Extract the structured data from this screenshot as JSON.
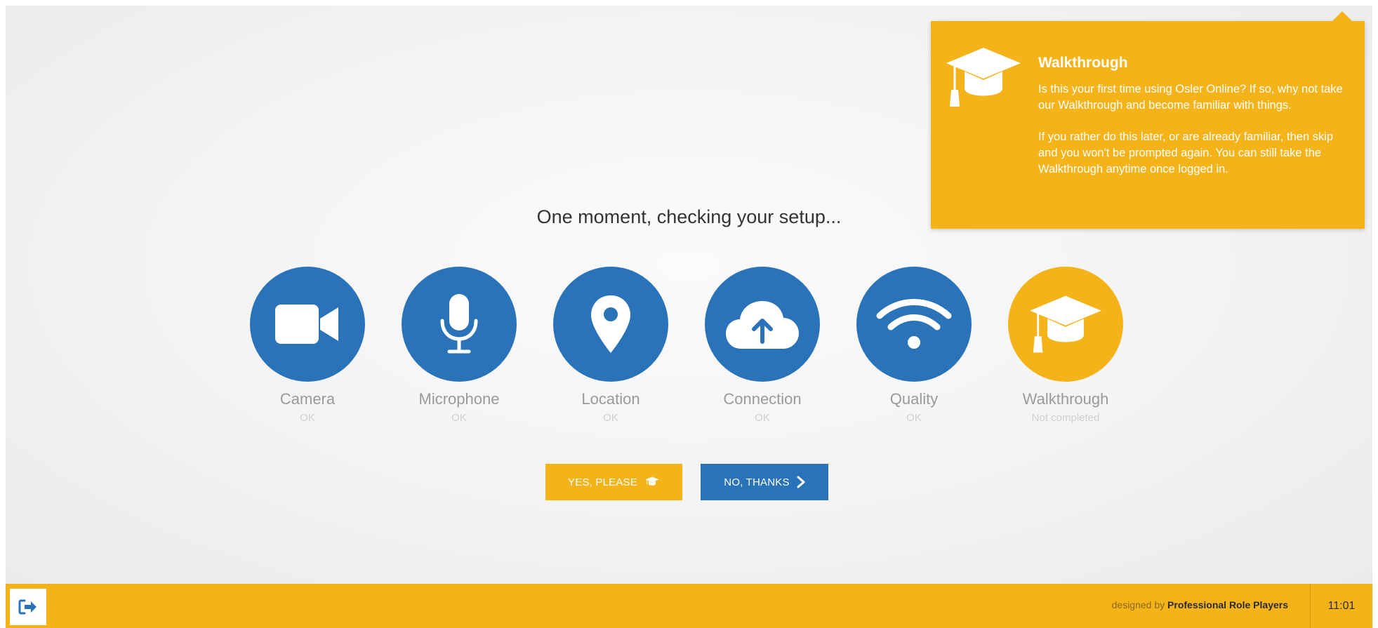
{
  "popover": {
    "title": "Walkthrough",
    "paragraph1": "Is this your first time using Osler Online? If so, why not take our Walkthrough and become familiar with things.",
    "paragraph2": "If you rather do this later, or are already familiar, then skip and you won't be prompted again. You can still take the Walkthrough anytime once logged in.",
    "icon": "graduation-cap-icon"
  },
  "heading": "One moment, checking your setup...",
  "checks": [
    {
      "label": "Camera",
      "status": "OK",
      "icon": "video-camera-icon"
    },
    {
      "label": "Microphone",
      "status": "OK",
      "icon": "microphone-icon"
    },
    {
      "label": "Location",
      "status": "OK",
      "icon": "map-pin-icon"
    },
    {
      "label": "Connection",
      "status": "OK",
      "icon": "cloud-upload-icon"
    },
    {
      "label": "Quality",
      "status": "OK",
      "icon": "wifi-icon"
    },
    {
      "label": "Walkthrough",
      "status": "Not completed",
      "icon": "graduation-cap-icon"
    }
  ],
  "buttons": {
    "yes": "YES, PLEASE",
    "no": "NO, THANKS"
  },
  "footer": {
    "credit_prefix": "designed by",
    "credit_name": "Professional Role Players",
    "time": "11:01"
  },
  "colors": {
    "accent_gold": "#f5b31a",
    "accent_blue": "#2a73b8"
  }
}
